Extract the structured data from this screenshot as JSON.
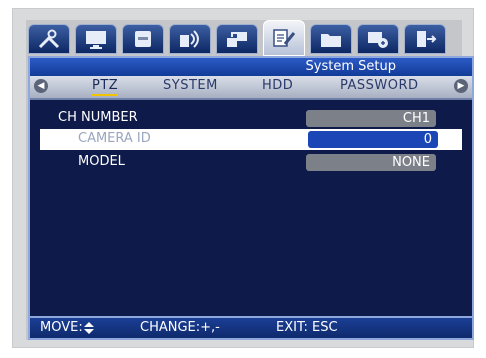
{
  "menu": {
    "icons": [
      {
        "name": "tools-icon"
      },
      {
        "name": "monitor-icon"
      },
      {
        "name": "hdd-icon"
      },
      {
        "name": "camera-audio-icon"
      },
      {
        "name": "network-icon"
      },
      {
        "name": "system-setup-icon",
        "active": true
      },
      {
        "name": "folder-icon"
      },
      {
        "name": "backup-icon"
      },
      {
        "name": "exit-icon"
      }
    ]
  },
  "title": "System Setup",
  "subtabs": [
    {
      "label": "PTZ",
      "active": true
    },
    {
      "label": "SYSTEM"
    },
    {
      "label": "HDD"
    },
    {
      "label": "PASSWORD"
    }
  ],
  "fields": [
    {
      "label": "CH NUMBER",
      "value": "CH1"
    },
    {
      "label": "CAMERA ID",
      "value": "0",
      "selected": true
    },
    {
      "label": "MODEL",
      "value": "NONE"
    }
  ],
  "footer": {
    "move": "MOVE:",
    "change": "CHANGE:+,-",
    "exit": "EXIT: ESC"
  }
}
